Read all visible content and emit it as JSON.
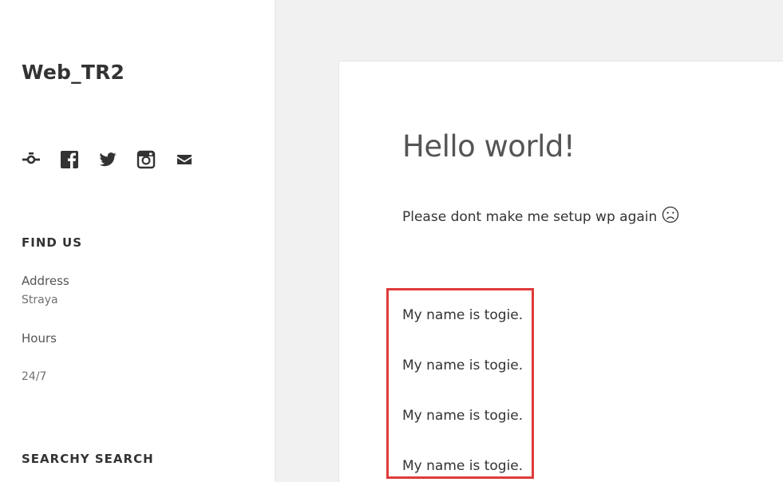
{
  "site": {
    "title": "Web_TR2"
  },
  "social_icons": [
    "wordpress-icon",
    "facebook-icon",
    "twitter-icon",
    "instagram-icon",
    "mail-icon"
  ],
  "widgets": {
    "find_us": {
      "title": "FIND US",
      "address_label": "Address",
      "address_value": "Straya",
      "hours_label": "Hours",
      "hours_value": "24/7"
    },
    "search": {
      "title": "SEARCHY SEARCH"
    }
  },
  "post": {
    "title": "Hello world!",
    "intro": "Please dont make me setup wp again",
    "intro_emoji": "sad-face-icon",
    "lines": [
      "My name is togie.",
      "My name is togie.",
      "My name is togie.",
      "My name is togie."
    ]
  },
  "colors": {
    "highlight_border": "#e03a3a",
    "background": "#f1f1f1"
  }
}
